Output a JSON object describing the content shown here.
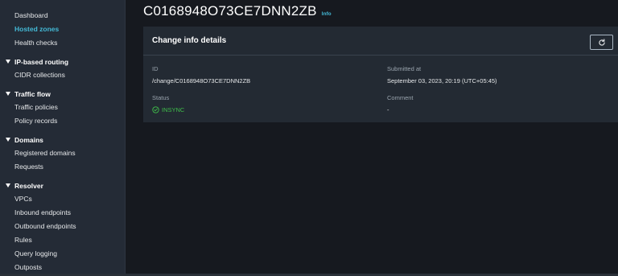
{
  "sidebar": {
    "top_items": [
      {
        "label": "Dashboard",
        "active": false
      },
      {
        "label": "Hosted zones",
        "active": true
      },
      {
        "label": "Health checks",
        "active": false
      }
    ],
    "sections": [
      {
        "label": "IP-based routing",
        "items": [
          "CIDR collections"
        ]
      },
      {
        "label": "Traffic flow",
        "items": [
          "Traffic policies",
          "Policy records"
        ]
      },
      {
        "label": "Domains",
        "items": [
          "Registered domains",
          "Requests"
        ]
      },
      {
        "label": "Resolver",
        "items": [
          "VPCs",
          "Inbound endpoints",
          "Outbound endpoints",
          "Rules",
          "Query logging",
          "Outposts"
        ]
      }
    ]
  },
  "header": {
    "title": "C0168948O73CE7DNN2ZB",
    "info_link": "Info"
  },
  "panel": {
    "title": "Change info details",
    "refresh_icon": "refresh-icon",
    "fields": {
      "id": {
        "label": "ID",
        "value": "/change/C0168948O73CE7DNN2ZB"
      },
      "submitted": {
        "label": "Submitted at",
        "value": "September 03, 2023, 20:19 (UTC+05:45)"
      },
      "status": {
        "label": "Status",
        "value": "INSYNC",
        "icon": "check-circle-icon"
      },
      "comment": {
        "label": "Comment",
        "value": "-"
      }
    }
  },
  "colors": {
    "accent_link": "#44b9d6",
    "status_success": "#3fbf4a",
    "sidebar_bg": "#242b36",
    "page_bg": "#16191f",
    "panel_bg": "#232a33"
  }
}
